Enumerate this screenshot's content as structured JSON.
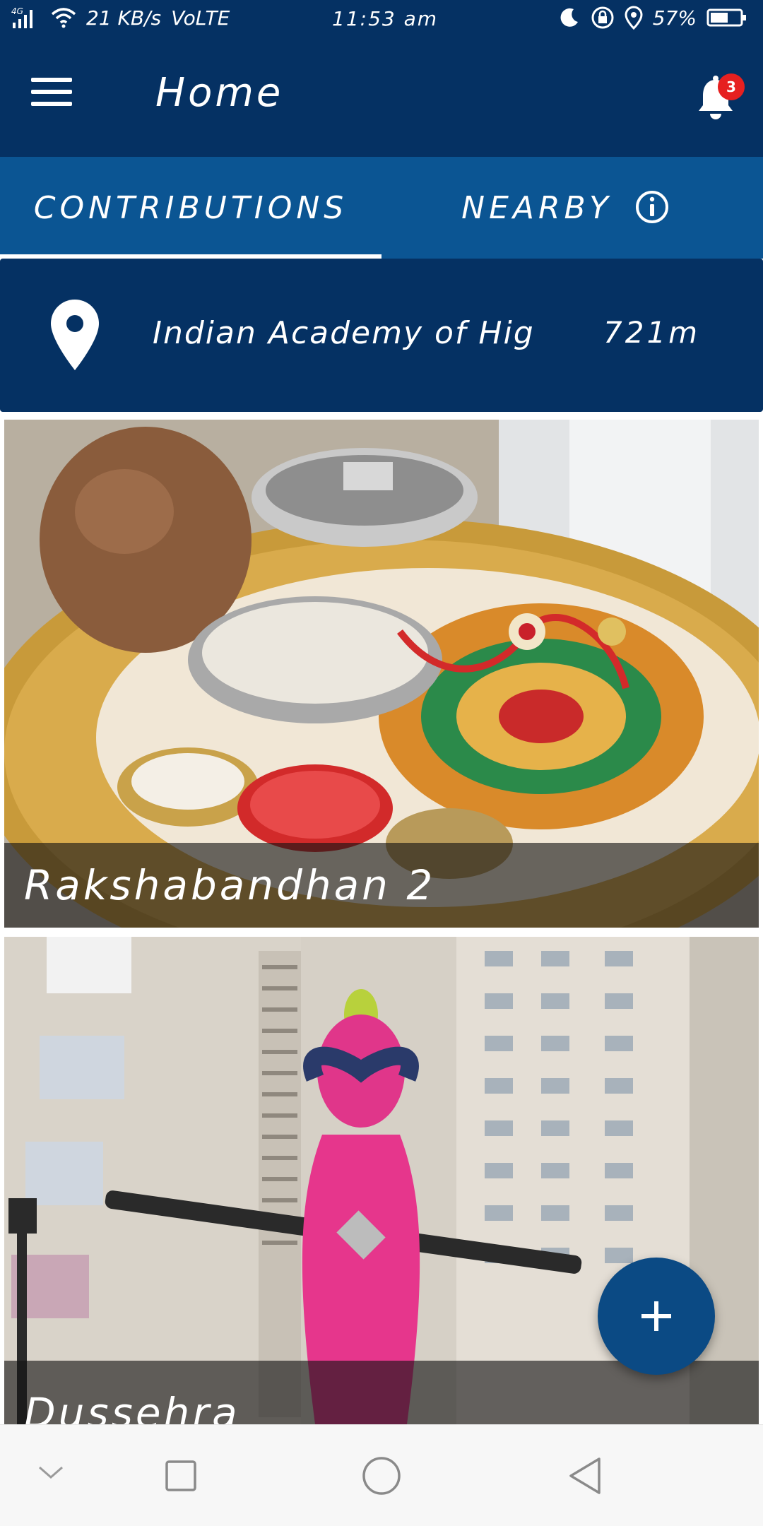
{
  "status_bar": {
    "network": "4G",
    "speed": "21 KB/s",
    "volte": "VoLTE",
    "time": "11:53 am",
    "battery": "57%"
  },
  "app_bar": {
    "title": "Home",
    "notification_count": "3"
  },
  "tabs": [
    {
      "label": "CONTRIBUTIONS",
      "selected": true
    },
    {
      "label": "NEARBY",
      "selected": false
    }
  ],
  "location": {
    "name": "Indian Academy of Hig...",
    "distance": "721m"
  },
  "feed": [
    {
      "caption": "Rakshabandhan 2"
    },
    {
      "caption": "Dussehra"
    }
  ],
  "colors": {
    "primary_dark": "#053163",
    "primary": "#0b5593",
    "badge": "#e62020",
    "fab": "#0b4a84"
  },
  "icons": {
    "menu": "hamburger-icon",
    "notifications": "bell-icon",
    "info": "info-icon",
    "location": "location-pin-icon",
    "fab": "plus-icon"
  }
}
